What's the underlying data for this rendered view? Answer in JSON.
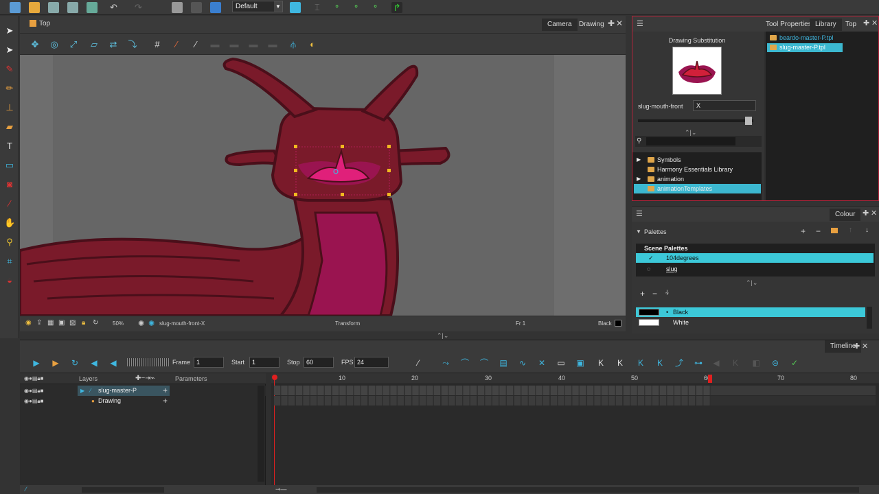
{
  "toolbar": {
    "workspace": "Default"
  },
  "camera_view": {
    "title": "Top",
    "tabs": [
      "Camera",
      "Drawing"
    ],
    "status": {
      "zoom": "50%",
      "drawing_name": "slug-mouth-front-X",
      "mode": "Transform",
      "frame": "Fr 1",
      "colour": "Black"
    }
  },
  "right_panel": {
    "tabs": [
      "Tool Properties",
      "Library",
      "Top"
    ],
    "drawing_substitution": {
      "title": "Drawing Substitution",
      "label": "slug-mouth-front",
      "value": "X"
    },
    "library_files": [
      {
        "name": "beardo-master-P.tpl",
        "selected": false
      },
      {
        "name": "slug-master-P.tpl",
        "selected": true
      }
    ],
    "library_tree": [
      {
        "name": "Symbols",
        "expandable": true,
        "selected": false
      },
      {
        "name": "Harmony Essentials Library",
        "expandable": false,
        "selected": false
      },
      {
        "name": "animation",
        "expandable": true,
        "selected": false
      },
      {
        "name": "animationTemplates",
        "expandable": false,
        "selected": true
      }
    ]
  },
  "colour_panel": {
    "tab": "Colour",
    "palettes_label": "Palettes",
    "scene_palettes_label": "Scene Palettes",
    "palettes": [
      {
        "name": "104degrees",
        "selected": true
      },
      {
        "name": "slug",
        "selected": false
      }
    ],
    "swatches": [
      {
        "name": "Black",
        "color": "#000000",
        "selected": true
      },
      {
        "name": "White",
        "color": "#ffffff",
        "selected": false
      }
    ]
  },
  "timeline": {
    "tab": "Timeline",
    "frame_label": "Frame",
    "frame_value": "1",
    "start_label": "Start",
    "start_value": "1",
    "stop_label": "Stop",
    "stop_value": "60",
    "fps_label": "FPS",
    "fps_value": "24",
    "layers_header": "Layers",
    "parameters_header": "Parameters",
    "layers": [
      {
        "name": "slug-master-P",
        "selected": true
      },
      {
        "name": "Drawing",
        "selected": false
      }
    ],
    "ruler_ticks": [
      "10",
      "20",
      "30",
      "40",
      "50",
      "60",
      "70",
      "80"
    ]
  },
  "colors": {
    "accent": "#3cb8d0",
    "slug_body": "#7a1a2a",
    "slug_outline": "#4a0f1a",
    "slug_belly": "#9a1450",
    "mouth": "#e0207a",
    "selection_handle": "#f0b820"
  }
}
